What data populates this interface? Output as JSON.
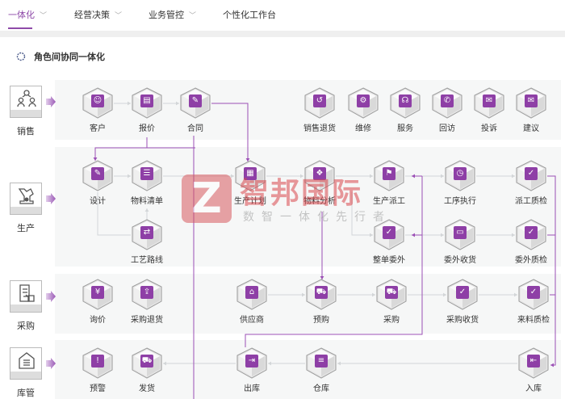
{
  "nav": {
    "tabs": [
      {
        "label": "一体化",
        "active": true,
        "chevron": true
      },
      {
        "label": "经营决策",
        "chevron": true
      },
      {
        "label": "业务管控",
        "chevron": true
      },
      {
        "label": "个性化工作台",
        "chevron": false
      }
    ]
  },
  "page": {
    "title": "角色间协同一体化",
    "title_icon": "cog-icon"
  },
  "roles": [
    {
      "id": "sales",
      "label": "销售",
      "icon": "people-network-icon"
    },
    {
      "id": "production",
      "label": "生产",
      "icon": "robot-arm-icon"
    },
    {
      "id": "purchase",
      "label": "采购",
      "icon": "purchase-doc-icon"
    },
    {
      "id": "warehouse",
      "label": "库管",
      "icon": "warehouse-icon"
    }
  ],
  "nodes": [
    {
      "id": "kehu",
      "label": "客户",
      "icon": "user-icon",
      "glyph": "☺"
    },
    {
      "id": "baojia",
      "label": "报价",
      "icon": "quote-doc-icon",
      "glyph": "▤"
    },
    {
      "id": "hetong",
      "label": "合同",
      "icon": "contract-icon",
      "glyph": "✎"
    },
    {
      "id": "xsth",
      "label": "销售退货",
      "icon": "return-icon",
      "glyph": "↺"
    },
    {
      "id": "weixiu",
      "label": "维修",
      "icon": "repair-icon",
      "glyph": "⚙"
    },
    {
      "id": "fuwu",
      "label": "服务",
      "icon": "headset-icon",
      "glyph": "☊"
    },
    {
      "id": "huifang",
      "label": "回访",
      "icon": "phone-icon",
      "glyph": "✆"
    },
    {
      "id": "tousu",
      "label": "投诉",
      "icon": "mail-icon",
      "glyph": "✉"
    },
    {
      "id": "jianyi",
      "label": "建议",
      "icon": "suggest-icon",
      "glyph": "✉"
    },
    {
      "id": "sheji",
      "label": "设计",
      "icon": "pencil-icon",
      "glyph": "✎"
    },
    {
      "id": "wlqd",
      "label": "物料清单",
      "icon": "clipboard-icon",
      "glyph": "☰"
    },
    {
      "id": "scjh",
      "label": "生产计划",
      "icon": "plan-icon",
      "glyph": "▦"
    },
    {
      "id": "wlfx",
      "label": "物料分析",
      "icon": "cubes-icon",
      "glyph": "❖"
    },
    {
      "id": "scpg",
      "label": "生产派工",
      "icon": "dispatch-icon",
      "glyph": "⚑"
    },
    {
      "id": "gxzx",
      "label": "工序执行",
      "icon": "process-icon",
      "glyph": "◷"
    },
    {
      "id": "pgzj",
      "label": "派工质检",
      "icon": "shield-check-icon",
      "glyph": "✓"
    },
    {
      "id": "gylx",
      "label": "工艺路线",
      "icon": "route-icon",
      "glyph": "⇄"
    },
    {
      "id": "zdww",
      "label": "整单委外",
      "icon": "clipboard-check-icon",
      "glyph": "✓"
    },
    {
      "id": "wwsh",
      "label": "委外收货",
      "icon": "card-icon",
      "glyph": "▭"
    },
    {
      "id": "wwzj",
      "label": "委外质检",
      "icon": "shield-check-icon",
      "glyph": "✓"
    },
    {
      "id": "xunjia",
      "label": "询价",
      "icon": "yen-icon",
      "glyph": "¥"
    },
    {
      "id": "cgth",
      "label": "采购退货",
      "icon": "basket-return-icon",
      "glyph": "⇪"
    },
    {
      "id": "gys",
      "label": "供应商",
      "icon": "store-icon",
      "glyph": "⌂"
    },
    {
      "id": "yugou",
      "label": "预购",
      "icon": "cart-icon",
      "glyph": "⛟"
    },
    {
      "id": "caigou",
      "label": "采购",
      "icon": "cart-icon",
      "glyph": "⛟"
    },
    {
      "id": "cgsh",
      "label": "采购收货",
      "icon": "bag-icon",
      "glyph": "✓"
    },
    {
      "id": "llzj",
      "label": "来料质检",
      "icon": "shield-check-icon",
      "glyph": "✓"
    },
    {
      "id": "yujing",
      "label": "预警",
      "icon": "warning-icon",
      "glyph": "!"
    },
    {
      "id": "fahuo",
      "label": "发货",
      "icon": "truck-icon",
      "glyph": "⛟"
    },
    {
      "id": "chuku",
      "label": "出库",
      "icon": "outbound-icon",
      "glyph": "⇥"
    },
    {
      "id": "cangku",
      "label": "仓库",
      "icon": "warehouse-icon",
      "glyph": "≡"
    },
    {
      "id": "ruku",
      "label": "入库",
      "icon": "inbound-icon",
      "glyph": "⇤"
    }
  ],
  "watermark": {
    "logo": "Z",
    "name": "智邦国际",
    "slogan": "数智一体化先行者"
  },
  "colors": {
    "accent": "#8e4aa8",
    "panel": "#f6f7f7",
    "watermark": "#d9484e"
  }
}
